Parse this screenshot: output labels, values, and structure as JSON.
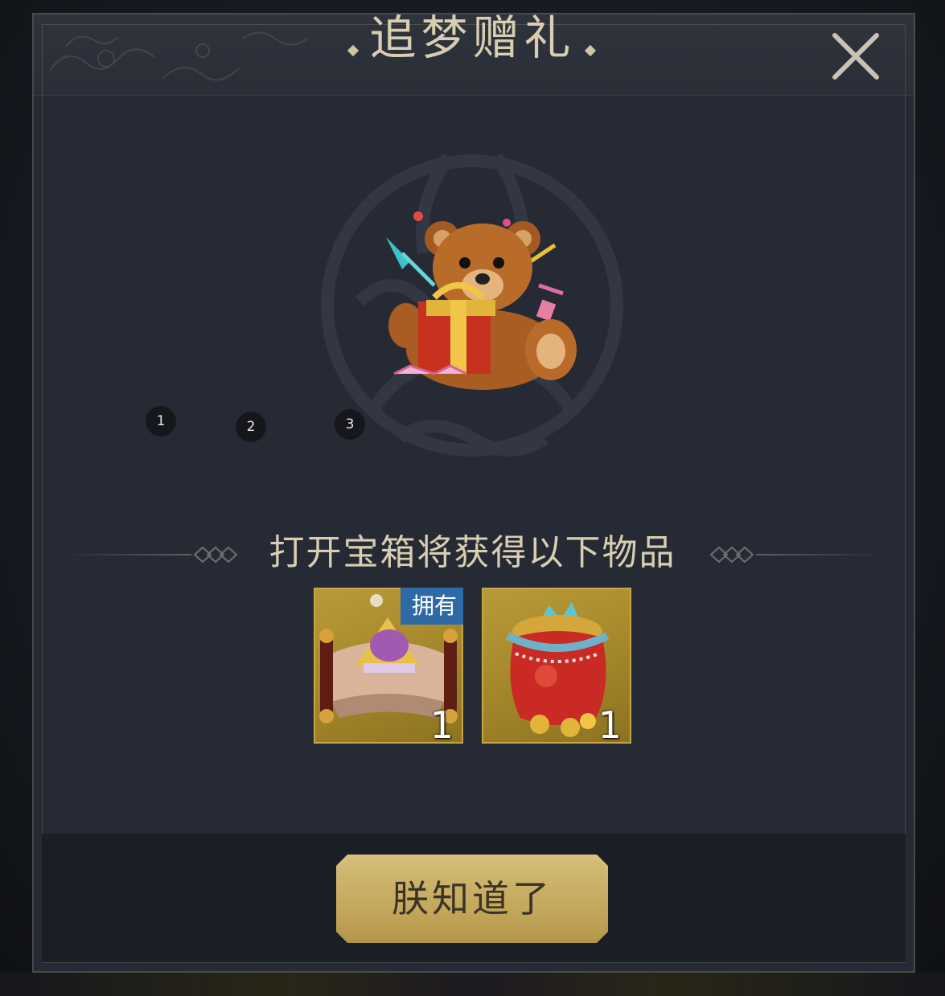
{
  "dialog": {
    "title": "追梦赠礼",
    "close_icon": "close-x-icon"
  },
  "featured_item": {
    "icon": "teddy-bear-gift-icon"
  },
  "step_markers": [
    "1",
    "2",
    "3"
  ],
  "rewards": {
    "heading": "打开宝箱将获得以下物品",
    "items": [
      {
        "icon": "scroll-treasure-icon",
        "count": "1",
        "badge": "拥有"
      },
      {
        "icon": "red-lucky-bag-icon",
        "count": "1"
      }
    ]
  },
  "confirm": {
    "label": "朕知道了"
  },
  "colors": {
    "title_gold": "#d9ceb3",
    "panel_bg": "#262a34",
    "item_gold": "#b89a3a",
    "badge_blue": "#2e6aa5",
    "button_gold": "#c8ab5e"
  }
}
